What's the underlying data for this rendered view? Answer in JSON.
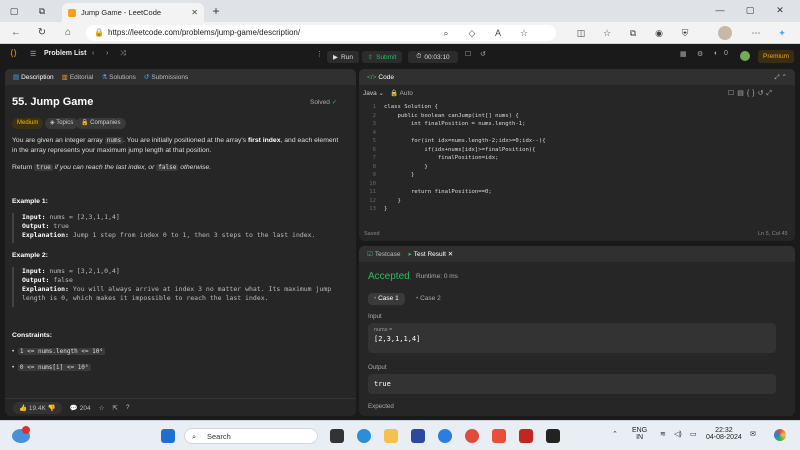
{
  "browser": {
    "tab_title": "Jump Game - LeetCode",
    "new_tab": "+",
    "url": "https://leetcode.com/problems/jump-game/description/"
  },
  "lc_header": {
    "problem_list": "Problem List",
    "run": "Run",
    "submit": "Submit",
    "timer": "00:03:10",
    "coins": "0",
    "premium": "Premium"
  },
  "desc_tabs": [
    "Description",
    "Editorial",
    "Solutions",
    "Submissions"
  ],
  "problem": {
    "title": "55. Jump Game",
    "solved": "Solved",
    "difficulty": "Medium",
    "topics": "Topics",
    "companies": "Companies",
    "p1a": "You are given an integer array ",
    "p1code": "nums",
    "p1b": ". You are initially positioned at the array's ",
    "p1bold": "first index",
    "p1c": ", and each element in the array represents your maximum jump length at that position.",
    "p2a": "Return ",
    "p2code1": "true",
    "p2b": " if you can reach the last index, or ",
    "p2code2": "false",
    "p2c": " otherwise.",
    "ex1_title": "Example 1:",
    "ex1_input_k": "Input:",
    "ex1_input_v": " nums = [2,3,1,1,4]",
    "ex1_output_k": "Output:",
    "ex1_output_v": " true",
    "ex1_expl_k": "Explanation:",
    "ex1_expl_v": " Jump 1 step from index 0 to 1, then 3 steps to the last index.",
    "ex2_title": "Example 2:",
    "ex2_input_k": "Input:",
    "ex2_input_v": " nums = [3,2,1,0,4]",
    "ex2_output_k": "Output:",
    "ex2_output_v": " false",
    "ex2_expl_k": "Explanation:",
    "ex2_expl_v1": " You will always arrive at index 3 no matter what. Its maximum jump",
    "ex2_expl_v2": "length is 0, which makes it impossible to reach the last index.",
    "constraints_title": "Constraints:",
    "c1": "1 <= nums.length <= 10⁴",
    "c2": "0 <= nums[i] <= 10⁵",
    "likes": "19.4K",
    "comments": "204"
  },
  "code_panel": {
    "title": "Code",
    "language": "Java",
    "auto": "Auto",
    "status": "Saved",
    "cursor": "Ln 5, Col 45",
    "lines": [
      "class Solution {",
      "    public boolean canJump(int[] nums) {",
      "        int finalPosition = nums.length-1;",
      "",
      "        for(int idx=nums.length-2;idx>=0;idx--){",
      "            if(idx+nums[idx]>=finalPosition){",
      "                finalPosition=idx;",
      "            }",
      "        }",
      "",
      "        return finalPosition==0;",
      "    }",
      "}"
    ]
  },
  "result_panel": {
    "tab1": "Testcase",
    "tab2": "Test Result",
    "status": "Accepted",
    "runtime": "Runtime: 0 ms",
    "case1": "Case 1",
    "case2": "Case 2",
    "input_label": "Input",
    "input_var": "nums =",
    "input_val": "[2,3,1,1,4]",
    "output_label": "Output",
    "output_val": "true",
    "expected_label": "Expected"
  },
  "taskbar": {
    "search": "Search",
    "lang1": "ENG",
    "lang2": "IN",
    "time": "22:32",
    "date": "04-08-2024"
  }
}
